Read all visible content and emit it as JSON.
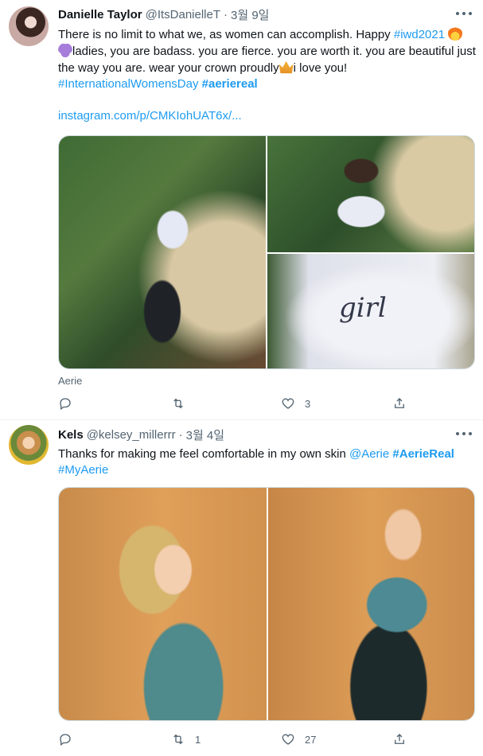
{
  "tweets": [
    {
      "name": "Danielle Taylor",
      "handle": "@ItsDanielleT",
      "dot": "·",
      "time": "3월 9일",
      "text_part1": "There is no limit to what we, as women can accomplish. Happy ",
      "hashtag1": "#iwd2021",
      "text_part2": "ladies, you are badass. you are fierce. you are worth it. you are beautiful just the way you are. wear your crown proudly",
      "text_part3": "i love you!",
      "hashtag2": "#InternationalWomensDay",
      "hashtag3": "#aeriereal",
      "link": "instagram.com/p/CMKIohUAT6x/...",
      "photo_text": "girl",
      "source": "Aerie",
      "replies": "",
      "retweets": "",
      "likes": "3"
    },
    {
      "name": "Kels",
      "handle": "@kelsey_millerrr",
      "dot": "·",
      "time": "3월 4일",
      "text_part1": "Thanks for making me feel comfortable in my own skin ",
      "mention": "@Aerie",
      "hashtag1": "#AerieReal",
      "hashtag2": "#MyAerie",
      "replies": "",
      "retweets": "1",
      "likes": "27"
    }
  ],
  "colors": {
    "link": "#1d9bf0",
    "secondary": "#536471",
    "text": "#0f1419"
  },
  "icons": [
    "reply-icon",
    "retweet-icon",
    "like-icon",
    "share-icon",
    "more-icon",
    "fire-emoji",
    "purple-heart-emoji",
    "crown-emoji"
  ]
}
